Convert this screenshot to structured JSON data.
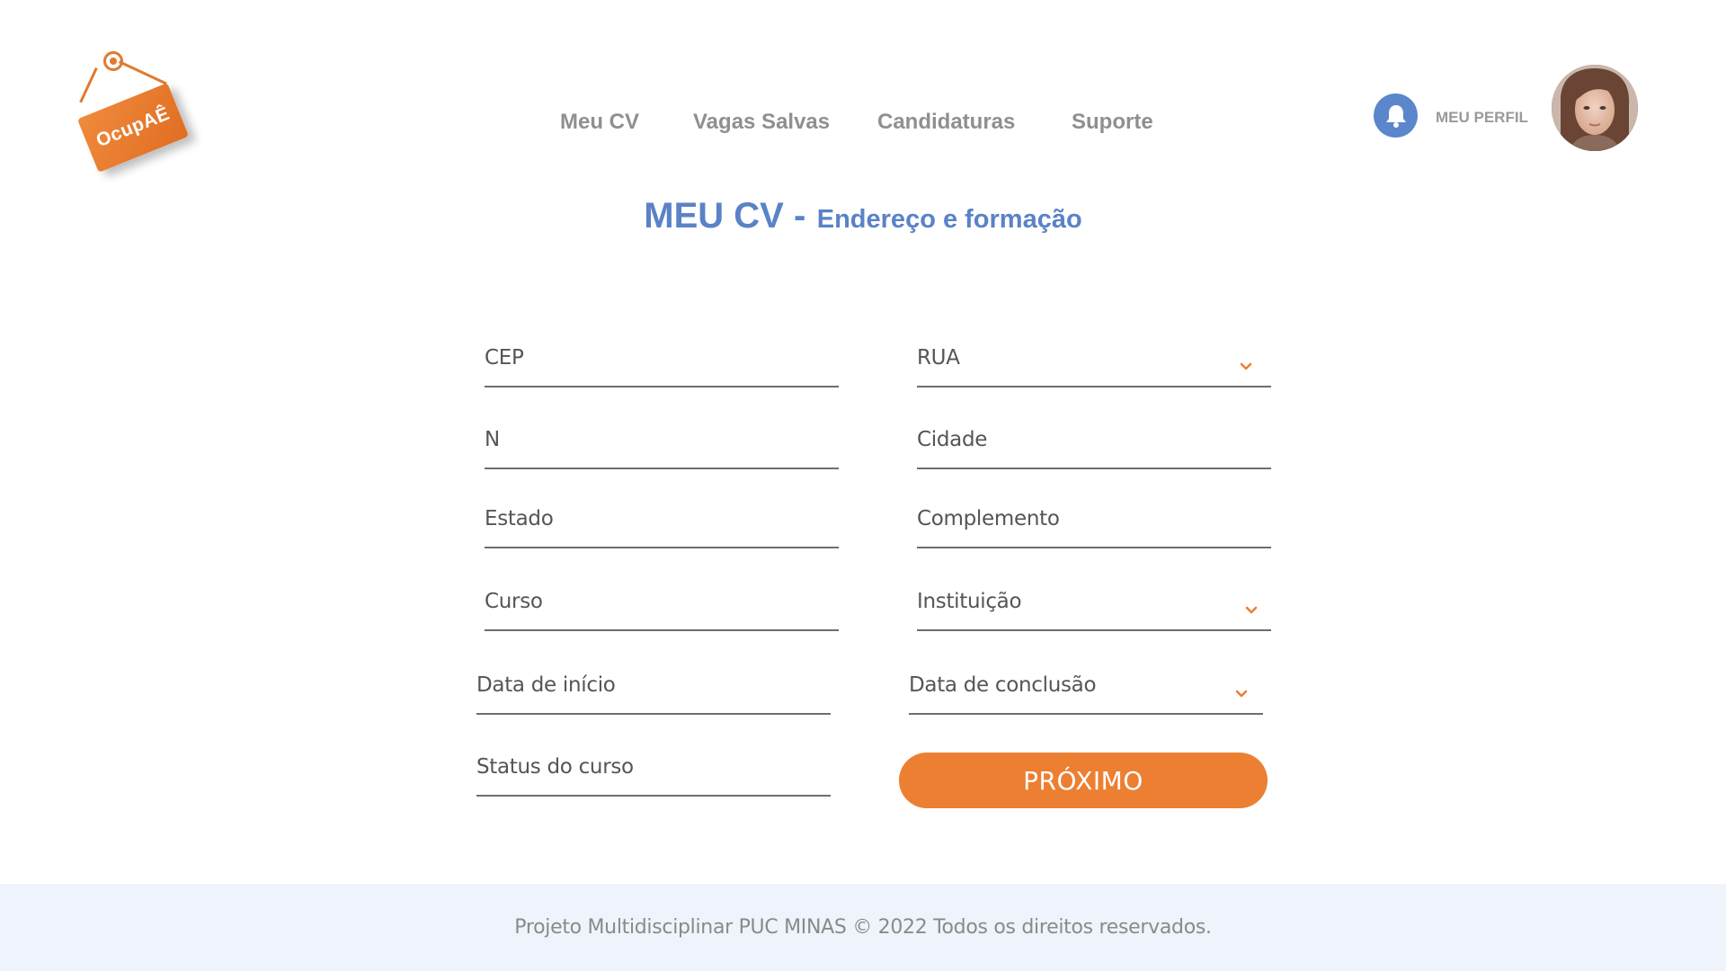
{
  "logo": {
    "text": "OcupAÊ"
  },
  "nav": {
    "items": [
      {
        "label": "Meu CV"
      },
      {
        "label": "Vagas Salvas"
      },
      {
        "label": "Candidaturas"
      },
      {
        "label": "Suporte"
      }
    ]
  },
  "header": {
    "notification_icon": "bell-icon",
    "profile_label": "MEU PERFIL",
    "avatar": "user-avatar-photo"
  },
  "page": {
    "title_main": "MEU CV -",
    "title_sub": "Endereço e formação"
  },
  "form": {
    "fields": {
      "cep": "CEP",
      "rua": "RUA",
      "numero": "N",
      "cidade": "Cidade",
      "estado": "Estado",
      "complemento": "Complemento",
      "curso": "Curso",
      "instituicao": "Instituição",
      "data_inicio": "Data de início",
      "data_conclusao": "Data de conclusão",
      "status_curso": "Status do curso"
    },
    "next_button": "PRÓXIMO"
  },
  "footer": {
    "text": "Projeto Multidisciplinar  PUC MINAS © 2022 Todos os direitos reservados."
  },
  "colors": {
    "accent_orange": "#ec7f32",
    "title_blue": "#5a82c7",
    "nav_gray": "#8f8f8f",
    "footer_bg": "#eff3fb"
  }
}
